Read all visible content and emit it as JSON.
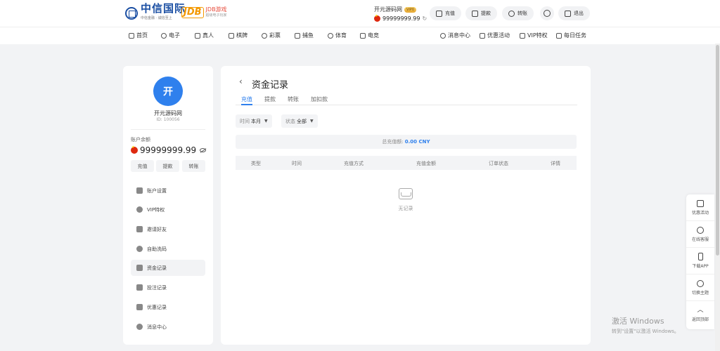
{
  "header": {
    "logo_text": "中信国际",
    "logo_sub": "中信金融 · 诚信至上",
    "partner_logo": "JDB",
    "partner_text": "JDB游戏",
    "partner_sub": "超级电子玩家",
    "username": "开元源码网",
    "vip_badge": "VIP0",
    "balance": "99999999.99",
    "buttons": {
      "deposit": "充值",
      "withdraw": "提款",
      "transfer": "转账",
      "logout": "退出"
    }
  },
  "nav": {
    "left": [
      "首页",
      "电子",
      "真人",
      "棋牌",
      "彩票",
      "捕鱼",
      "体育",
      "电竞"
    ],
    "right": [
      "消息中心",
      "优惠活动",
      "VIP特权",
      "每日任务"
    ]
  },
  "sidebar": {
    "avatar_char": "开",
    "name": "开元源码网",
    "id": "ID: 100056",
    "balance_label": "账户余额",
    "balance": "99999999.99",
    "actions": [
      "充值",
      "提款",
      "转账"
    ],
    "menu": [
      {
        "label": "账户设置",
        "icon": "id-card-icon"
      },
      {
        "label": "VIP特权",
        "icon": "heart-icon"
      },
      {
        "label": "邀请好友",
        "icon": "handshake-icon"
      },
      {
        "label": "自助洗码",
        "icon": "chip-icon"
      },
      {
        "label": "资金记录",
        "icon": "card-icon"
      },
      {
        "label": "投注记录",
        "icon": "clipboard-icon"
      },
      {
        "label": "优惠记录",
        "icon": "gift-icon"
      },
      {
        "label": "消息中心",
        "icon": "chat-icon"
      }
    ],
    "active_index": 4
  },
  "main": {
    "title": "资金记录",
    "tabs": [
      "充值",
      "提款",
      "转账",
      "加扣款"
    ],
    "active_tab": 0,
    "filters": {
      "time_label": "时间",
      "time_value": "本月",
      "status_label": "状态",
      "status_value": "全部"
    },
    "summary_label": "总充值额:",
    "summary_value": "0.00 CNY",
    "columns": [
      "类型",
      "时间",
      "充值方式",
      "充值金额",
      "订单状态",
      "详情"
    ],
    "empty_text": "无记录"
  },
  "floatbar": [
    {
      "label": "优惠活动",
      "icon": "gift-icon"
    },
    {
      "label": "在线客服",
      "icon": "headset-icon"
    },
    {
      "label": "下载APP",
      "icon": "phone-icon"
    },
    {
      "label": "切换主题",
      "icon": "moon-icon"
    },
    {
      "label": "返回顶部",
      "icon": "chevron-up-icon"
    }
  ],
  "watermark": {
    "line1": "激活 Windows",
    "line2": "转到\"设置\"以激活 Windows。"
  },
  "colors": {
    "accent": "#2f80ed",
    "page_bg": "#f2f3f5",
    "flag_red": "#de2910"
  }
}
